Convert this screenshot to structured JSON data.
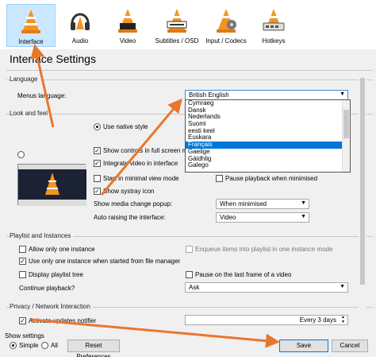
{
  "colors": {
    "accent": "#0078d7",
    "selected_bg": "#cce8ff",
    "arrow": "#e8772e",
    "cone": "#f39420"
  },
  "toolbar": {
    "categories": [
      {
        "label": "Interface",
        "icon": "vlc-cone-icon",
        "selected": true
      },
      {
        "label": "Audio",
        "icon": "headphones-icon",
        "selected": false
      },
      {
        "label": "Video",
        "icon": "video-cone-icon",
        "selected": false
      },
      {
        "label": "Subtitles / OSD",
        "icon": "subtitles-cone-icon",
        "selected": false
      },
      {
        "label": "Input / Codecs",
        "icon": "input-codecs-icon",
        "selected": false
      },
      {
        "label": "Hotkeys",
        "icon": "hotkeys-cone-icon",
        "selected": false
      }
    ]
  },
  "page_title": "Interface Settings",
  "language": {
    "section": "Language",
    "menus_language_label": "Menus language:",
    "selected": "British English",
    "options": [
      "Cymraeg",
      "Dansk",
      "Nederlands",
      "Suomi",
      "eesti keel",
      "Euskara",
      "Français",
      "Gaeilge",
      "Gàidhlig",
      "Galego"
    ],
    "highlighted": "Français"
  },
  "look_and_feel": {
    "section": "Look and feel",
    "use_native_style": "Use native style",
    "show_controls_fullscreen": "Show controls in full screen mo",
    "integrate_video": "Integrate video in interface",
    "start_minimal": "Start in minimal view mode",
    "show_systray": "Show systray icon",
    "pause_minimised": "Pause playback when minimised",
    "show_media_change_label": "Show media change popup:",
    "show_media_change_value": "When minimised",
    "auto_raising_label": "Auto raising the interface:",
    "auto_raising_value": "Video"
  },
  "playlist": {
    "section": "Playlist and Instances",
    "allow_one_instance": "Allow only one instance",
    "enqueue_items": "Enqueue items into playlist in one instance mode",
    "use_one_instance_file_manager": "Use only one instance when started from file manager",
    "display_playlist_tree": "Display playlist tree",
    "pause_last_frame": "Pause on the last frame of a video",
    "continue_playback_label": "Continue playback?",
    "continue_playback_value": "Ask"
  },
  "privacy": {
    "section": "Privacy / Network Interaction",
    "activate_updates": "Activate updates notifier",
    "update_interval": "Every 3 days"
  },
  "footer": {
    "show_settings": "Show settings",
    "simple": "Simple",
    "all": "All",
    "reset": "Reset Preferences",
    "save": "Save",
    "cancel": "Cancel"
  }
}
